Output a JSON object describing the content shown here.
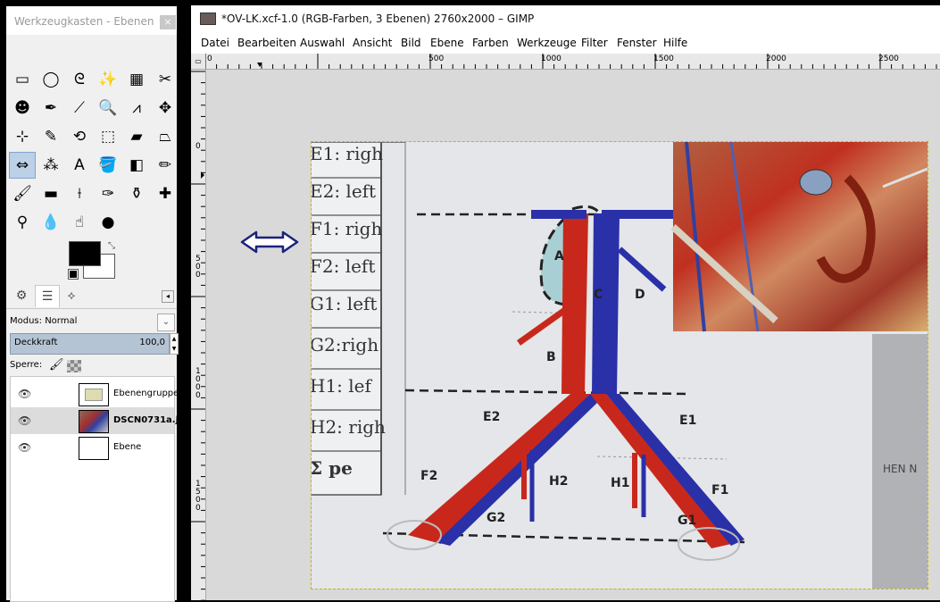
{
  "toolbox": {
    "title": "Werkzeugkasten - Ebenen",
    "close_label": "×",
    "tools": [
      {
        "icon": "rect-select-icon",
        "glyph": "▭"
      },
      {
        "icon": "ellipse-select-icon",
        "glyph": "◯"
      },
      {
        "icon": "free-select-icon",
        "glyph": "ᘓ"
      },
      {
        "icon": "fuzzy-select-icon",
        "glyph": "✨"
      },
      {
        "icon": "color-select-icon",
        "glyph": "▦"
      },
      {
        "icon": "scissors-select-icon",
        "glyph": "✂"
      },
      {
        "icon": "foreground-select-icon",
        "glyph": "☻"
      },
      {
        "icon": "paths-icon",
        "glyph": "✒"
      },
      {
        "icon": "color-picker-icon",
        "glyph": "⟋"
      },
      {
        "icon": "zoom-icon",
        "glyph": "🔍"
      },
      {
        "icon": "measure-icon",
        "glyph": "⩘"
      },
      {
        "icon": "move-icon",
        "glyph": "✥"
      },
      {
        "icon": "align-icon",
        "glyph": "⊹"
      },
      {
        "icon": "crop-icon",
        "glyph": "✎"
      },
      {
        "icon": "rotate-icon",
        "glyph": "⟲"
      },
      {
        "icon": "scale-icon",
        "glyph": "⬚"
      },
      {
        "icon": "shear-icon",
        "glyph": "▰"
      },
      {
        "icon": "perspective-icon",
        "glyph": "⏢"
      },
      {
        "icon": "flip-icon",
        "glyph": "⇔"
      },
      {
        "icon": "cage-transform-icon",
        "glyph": "⁂"
      },
      {
        "icon": "text-icon",
        "glyph": "A"
      },
      {
        "icon": "bucket-fill-icon",
        "glyph": "🪣"
      },
      {
        "icon": "blend-icon",
        "glyph": "◧"
      },
      {
        "icon": "pencil-icon",
        "glyph": "✏"
      },
      {
        "icon": "paintbrush-icon",
        "glyph": "🖌"
      },
      {
        "icon": "eraser-icon",
        "glyph": "▬"
      },
      {
        "icon": "airbrush-icon",
        "glyph": "⟊"
      },
      {
        "icon": "ink-icon",
        "glyph": "✑"
      },
      {
        "icon": "clone-icon",
        "glyph": "⚱"
      },
      {
        "icon": "heal-icon",
        "glyph": "✚"
      },
      {
        "icon": "perspective-clone-icon",
        "glyph": "⚲"
      },
      {
        "icon": "blur-icon",
        "glyph": "💧"
      },
      {
        "icon": "smudge-icon",
        "glyph": "☝"
      },
      {
        "icon": "dodge-burn-icon",
        "glyph": "●"
      }
    ],
    "colors": {
      "foreground": "#000000",
      "background": "#ffffff",
      "selected_tool_bg": "#bcd0e6"
    },
    "dock_tabs": [
      {
        "icon": "tool-options-icon",
        "glyph": "⚙"
      },
      {
        "icon": "layers-icon",
        "glyph": "☰"
      },
      {
        "icon": "paths-tab-icon",
        "glyph": "⟡"
      }
    ],
    "mode_label": "Modus: Normal",
    "opacity_label": "Deckkraft",
    "opacity_value": "100,0",
    "lock_label": "Sperre:",
    "layers": [
      {
        "name": "Ebenengruppe",
        "kind": "folder",
        "selected": false,
        "bold": false
      },
      {
        "name": "DSCN0731a.jp",
        "kind": "photo",
        "selected": true,
        "bold": true
      },
      {
        "name": "Ebene",
        "kind": "blank",
        "selected": false,
        "bold": false
      }
    ]
  },
  "image_window": {
    "title": "*OV-LK.xcf-1.0 (RGB-Farben, 3 Ebenen) 2760x2000 – GIMP",
    "menus": [
      "Datei",
      "Bearbeiten",
      "Auswahl",
      "Ansicht",
      "Bild",
      "Ebene",
      "Farben",
      "Werkzeuge",
      "Filter",
      "Fenster",
      "Hilfe"
    ],
    "hruler_ticks": [
      "0",
      "500",
      "1000",
      "1500",
      "2000",
      "2500"
    ],
    "vruler_ticks": [
      "0",
      "500",
      "1000",
      "1500"
    ],
    "image_text": {
      "table_rows": [
        "E1: righ",
        "E2: left",
        "F1: righ",
        "F2: left",
        "G1: left",
        "G2:righ",
        "H1: lef",
        "H2: righ",
        "Ʃ pe"
      ],
      "labels": [
        "A",
        "B",
        "C",
        "D",
        "E1",
        "E2",
        "F1",
        "F2",
        "G1",
        "G2",
        "H1",
        "H2"
      ],
      "right_edge_text": "HEN\nN"
    }
  }
}
